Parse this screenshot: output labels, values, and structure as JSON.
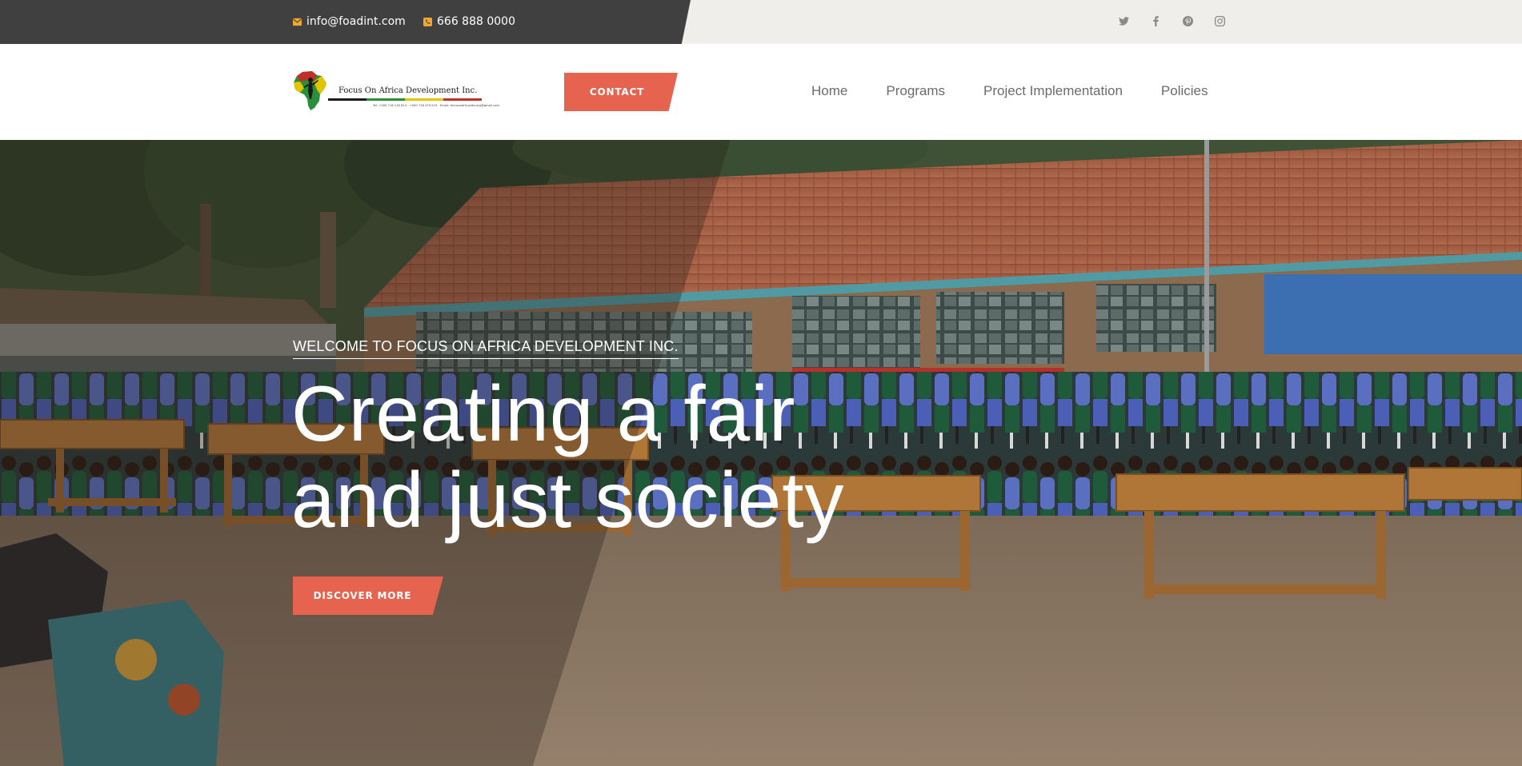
{
  "topbar": {
    "email": "info@foadint.com",
    "phone": "666 888 0000",
    "email_icon": "envelope-icon",
    "phone_icon": "phone-icon",
    "social": [
      "twitter-icon",
      "facebook-icon",
      "pinterest-icon",
      "instagram-icon"
    ]
  },
  "header": {
    "logo_text": "Focus On Africa Development Inc.",
    "logo_subtext": "Tel: +000 716 116 614 · +000 716 470 019 · Email: focusonafricadev.org@gmail.com",
    "contact_button": "CONTACT",
    "nav": [
      "Home",
      "Programs",
      "Project Implementation",
      "Policies"
    ]
  },
  "hero": {
    "eyebrow": "WELCOME TO FOCUS ON AFRICA DEVELOPMENT INC.",
    "title_line1": "Creating a fair",
    "title_line2": "and just society",
    "button": "DISCOVER MORE"
  },
  "colors": {
    "accent": "#e5634f",
    "topbar_dark": "#404040",
    "topbar_light": "#f0eeeb",
    "nav_text": "#6b6b6b",
    "icon_orange": "#f0a830"
  }
}
